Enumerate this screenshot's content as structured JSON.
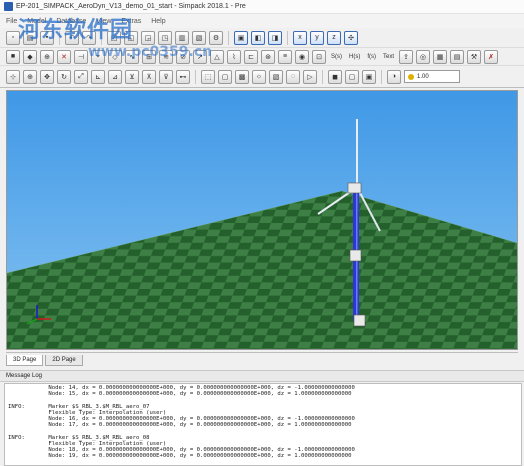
{
  "window": {
    "title": "EP-201_SIMPACK_AeroDyn_V13_demo_01_start - Simpack 2018.1 - Pre"
  },
  "menubar": {
    "items": [
      "File",
      "Model",
      "Database",
      "View",
      "Extras",
      "Help"
    ]
  },
  "toolbar": {
    "text_buttons": {
      "sm": "S(s)",
      "h": "H(s)",
      "f": "f(s)",
      "text": "Text"
    },
    "zoom_value": "1.00"
  },
  "watermark": {
    "logo_text": "河东软件园",
    "site_text": "www.pc0359.cn"
  },
  "pagetabs": [
    "3D Page",
    "2D Page"
  ],
  "log": {
    "header": "Message Log",
    "lines": [
      "            Node: 14, dx = 0.000000000000000E+000, dy = 0.000000000000000E+000, dz = -1.000000000000000",
      "            Node: 15, dx = 0.000000000000000E+000, dy = 0.000000000000000E+000, dz = 1.000000000000000",
      "",
      "INFO:       Marker $S_RBL_3.$M_RBL_aero_07",
      "            Flexible Type: Interpolation (user)",
      "            Node: 16, dx = 0.000000000000000E+000, dy = 0.000000000000000E+000, dz = -1.000000000000000",
      "            Node: 17, dx = 0.000000000000000E+000, dy = 0.000000000000000E+000, dz = 1.000000000000000",
      "",
      "INFO:       Marker $S_RBL_3.$M_RBL_aero_08",
      "            Flexible Type: Interpolation (user)",
      "            Node: 18, dx = 0.000000000000000E+000, dy = 0.000000000000000E+000, dz = -1.000000000000000",
      "            Node: 19, dx = 0.000000000000000E+000, dy = 0.000000000000000E+000, dz = 1.000000000000000"
    ]
  },
  "colors": {
    "sky_top": "#4aa0e8",
    "sky_bottom": "#8fc8f4",
    "ground_dark": "#1f5a28",
    "ground_light": "#3c7e44",
    "tower": "#2a3ad8"
  }
}
